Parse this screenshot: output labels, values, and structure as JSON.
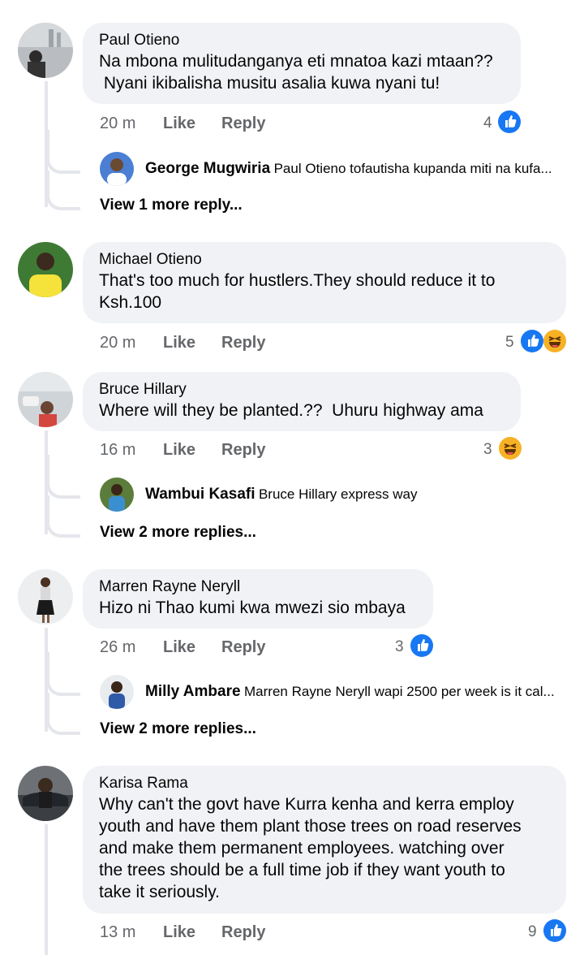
{
  "top_fragment": "· ·  · ·  ·  · · ·",
  "comments": [
    {
      "author": "Paul Otieno",
      "text": "Na mbona mulitudanganya eti mnatoa kazi mtaan??\n Nyani ikibalisha musitu asalia kuwa nyani tu!",
      "time": "20 m",
      "like": "Like",
      "reply": "Reply",
      "reactions_count": "4",
      "reply_preview": {
        "author": "George Mugwiria",
        "text": "Paul Otieno tofautisha kupanda miti na kufa..."
      },
      "more_replies": "View 1 more reply..."
    },
    {
      "author": "Michael Otieno",
      "text": "That's too much for hustlers.They should reduce it to\nKsh.100",
      "time": "20 m",
      "like": "Like",
      "reply": "Reply",
      "reactions_count": "5"
    },
    {
      "author": "Bruce Hillary",
      "text": "Where will they be planted.??  Uhuru highway ama",
      "time": "16 m",
      "like": "Like",
      "reply": "Reply",
      "reactions_count": "3",
      "reply_preview": {
        "author": "Wambui Kasafi",
        "text": "Bruce Hillary express way"
      },
      "more_replies": "View 2 more replies..."
    },
    {
      "author": "Marren Rayne Neryll",
      "text": "Hizo ni Thao kumi kwa mwezi sio mbaya",
      "time": "26 m",
      "like": "Like",
      "reply": "Reply",
      "reactions_count": "3",
      "reply_preview": {
        "author": "Milly Ambare",
        "text": "Marren Rayne Neryll wapi 2500 per week is it cal..."
      },
      "more_replies": "View 2 more replies..."
    },
    {
      "author": "Karisa Rama",
      "text": "Why can't the govt have Kurra kenha and kerra employ\nyouth and have them plant those trees on road reserves\nand make them permanent employees. watching over\nthe trees should be a full time job if they want youth to\ntake it seriously.",
      "time": "13 m",
      "like": "Like",
      "reply": "Reply",
      "reactions_count": "9"
    }
  ],
  "colors": {
    "bubble": "#f0f2f5",
    "like_blue": "#1877f2",
    "haha_yellow": "#f7b125",
    "meta_gray": "#65676b",
    "thread_line": "#e4e6eb"
  }
}
